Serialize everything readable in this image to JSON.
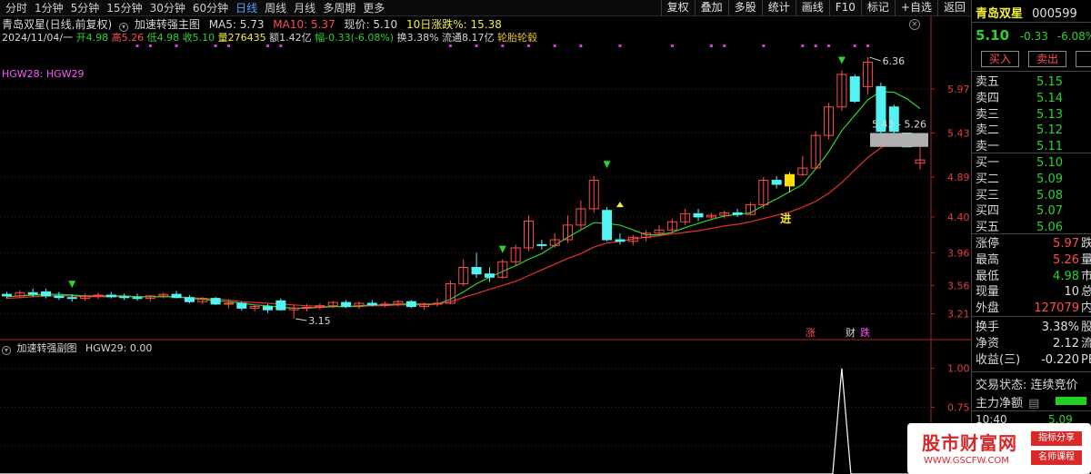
{
  "toolbar": {
    "periods": [
      "分时",
      "1分钟",
      "5分钟",
      "15分钟",
      "30分钟",
      "60分钟",
      "日线",
      "周线",
      "月线",
      "多周期",
      "更多"
    ],
    "active_period": "日线",
    "tools": [
      "复权",
      "叠加",
      "多股",
      "统计",
      "画线",
      "F10",
      "标记",
      "+自选",
      "返回"
    ]
  },
  "main_header": {
    "title": "青岛双星(日线,前复权)",
    "indicator_name": "加速转强主图",
    "ma5_label": "MA5: 5.73",
    "ma10_label": "MA10: 5.37",
    "price_label": "现价: 5.10",
    "change10_label": "10日涨跌%: 15.38",
    "date": "2024/11/04/一",
    "open": "开4.98",
    "high": "高5.26",
    "low": "低4.98",
    "close": "收5.10",
    "volume": "量276435",
    "amount": "额1.42亿",
    "amplitude": "幅-0.33(-6.08%)",
    "turnover": "换3.38%",
    "float": "流通8.17亿",
    "pattern": "轮胎轮毂",
    "hgw_label": "HGW28: HGW29"
  },
  "sub_header": {
    "indicator_name": "加速转强副图",
    "value_label": "HGW29: 0.00"
  },
  "colors": {
    "up": "#ff4d4d",
    "down": "#53f3f3",
    "ma5": "#eaeaea",
    "ma10": "#2ed12e",
    "ma20": "#e83232",
    "highlight": "#ffe000"
  },
  "chart_data": [
    {
      "type": "candlestick",
      "title": "",
      "price_ticks": [
        "5.97",
        "5.43",
        "4.89",
        "4.40",
        "3.96",
        "3.56",
        "3.21"
      ],
      "tick_values": [
        5.97,
        5.43,
        4.89,
        4.4,
        3.96,
        3.56,
        3.21
      ],
      "ylim": [
        3.05,
        6.45
      ],
      "candles": [
        [
          3.45,
          3.48,
          3.4,
          3.43
        ],
        [
          3.43,
          3.5,
          3.4,
          3.47
        ],
        [
          3.47,
          3.52,
          3.42,
          3.45
        ],
        [
          3.48,
          3.52,
          3.4,
          3.43
        ],
        [
          3.43,
          3.48,
          3.38,
          3.41
        ],
        [
          3.41,
          3.45,
          3.36,
          3.4
        ],
        [
          3.4,
          3.46,
          3.37,
          3.43
        ],
        [
          3.43,
          3.47,
          3.39,
          3.44
        ],
        [
          3.44,
          3.48,
          3.4,
          3.42
        ],
        [
          3.42,
          3.46,
          3.38,
          3.41
        ],
        [
          3.41,
          3.46,
          3.37,
          3.4
        ],
        [
          3.4,
          3.44,
          3.36,
          3.43
        ],
        [
          3.43,
          3.47,
          3.4,
          3.45
        ],
        [
          3.45,
          3.49,
          3.4,
          3.41
        ],
        [
          3.41,
          3.44,
          3.34,
          3.36
        ],
        [
          3.36,
          3.42,
          3.33,
          3.4
        ],
        [
          3.4,
          3.42,
          3.32,
          3.33
        ],
        [
          3.33,
          3.38,
          3.28,
          3.34
        ],
        [
          3.34,
          3.36,
          3.25,
          3.28
        ],
        [
          3.28,
          3.32,
          3.24,
          3.3
        ],
        [
          3.3,
          3.33,
          3.22,
          3.26
        ],
        [
          3.37,
          3.4,
          3.25,
          3.26
        ],
        [
          3.26,
          3.32,
          3.15,
          3.28
        ],
        [
          3.28,
          3.33,
          3.24,
          3.29
        ],
        [
          3.29,
          3.34,
          3.26,
          3.31
        ],
        [
          3.31,
          3.37,
          3.28,
          3.35
        ],
        [
          3.35,
          3.38,
          3.28,
          3.3
        ],
        [
          3.3,
          3.36,
          3.27,
          3.34
        ],
        [
          3.34,
          3.38,
          3.3,
          3.32
        ],
        [
          3.32,
          3.36,
          3.29,
          3.33
        ],
        [
          3.33,
          3.38,
          3.3,
          3.36
        ],
        [
          3.36,
          3.38,
          3.28,
          3.3
        ],
        [
          3.3,
          3.35,
          3.26,
          3.33
        ],
        [
          3.33,
          3.4,
          3.3,
          3.34
        ],
        [
          3.34,
          3.62,
          3.33,
          3.58
        ],
        [
          3.58,
          3.88,
          3.55,
          3.78
        ],
        [
          3.78,
          3.96,
          3.65,
          3.7
        ],
        [
          3.7,
          3.78,
          3.6,
          3.66
        ],
        [
          3.66,
          3.88,
          3.64,
          3.85
        ],
        [
          3.85,
          4.06,
          3.8,
          4.02
        ],
        [
          4.02,
          4.42,
          3.98,
          4.35
        ],
        [
          4.06,
          4.12,
          4.0,
          4.05
        ],
        [
          4.05,
          4.2,
          4.02,
          4.12
        ],
        [
          4.12,
          4.42,
          4.08,
          4.3
        ],
        [
          4.3,
          4.6,
          4.25,
          4.5
        ],
        [
          4.5,
          4.9,
          4.45,
          4.85
        ],
        [
          4.48,
          4.52,
          4.1,
          4.12
        ],
        [
          4.12,
          4.2,
          4.06,
          4.1
        ],
        [
          4.1,
          4.18,
          4.05,
          4.15
        ],
        [
          4.15,
          4.24,
          4.1,
          4.2
        ],
        [
          4.2,
          4.3,
          4.16,
          4.24
        ],
        [
          4.24,
          4.38,
          4.2,
          4.34
        ],
        [
          4.34,
          4.5,
          4.3,
          4.44
        ],
        [
          4.44,
          4.5,
          4.35,
          4.4
        ],
        [
          4.4,
          4.45,
          4.36,
          4.42
        ],
        [
          4.42,
          4.48,
          4.38,
          4.45
        ],
        [
          4.45,
          4.5,
          4.4,
          4.43
        ],
        [
          4.43,
          4.58,
          4.42,
          4.55
        ],
        [
          4.55,
          4.89,
          4.5,
          4.85
        ],
        [
          4.85,
          4.9,
          4.75,
          4.8
        ],
        [
          4.78,
          4.95,
          4.7,
          4.92
        ],
        [
          4.92,
          5.15,
          4.9,
          5.0
        ],
        [
          5.0,
          5.45,
          4.98,
          5.4
        ],
        [
          5.4,
          5.8,
          5.35,
          5.75
        ],
        [
          5.75,
          6.2,
          5.7,
          6.15
        ],
        [
          6.12,
          6.15,
          5.8,
          5.82
        ],
        [
          6.0,
          6.36,
          5.9,
          6.3
        ],
        [
          6.0,
          6.05,
          5.35,
          5.45
        ],
        [
          5.75,
          5.78,
          5.4,
          5.45
        ],
        [
          5.43,
          5.43,
          5.26,
          5.26
        ],
        [
          5.06,
          5.26,
          4.98,
          5.1
        ]
      ],
      "ma10": [
        3.4,
        3.41,
        3.42,
        3.43,
        3.43,
        3.43,
        3.42,
        3.42,
        3.42,
        3.42,
        3.42,
        3.42,
        3.42,
        3.42,
        3.41,
        3.4,
        3.39,
        3.38,
        3.36,
        3.35,
        3.34,
        3.33,
        3.32,
        3.31,
        3.3,
        3.3,
        3.3,
        3.3,
        3.31,
        3.31,
        3.32,
        3.32,
        3.32,
        3.33,
        3.36,
        3.41,
        3.46,
        3.51,
        3.56,
        3.61,
        3.68,
        3.75,
        3.82,
        3.89,
        3.95,
        4.03,
        4.08,
        4.1,
        4.13,
        4.15,
        4.17,
        4.19,
        4.21,
        4.23,
        4.26,
        4.29,
        4.31,
        4.34,
        4.38,
        4.42,
        4.46,
        4.52,
        4.59,
        4.69,
        4.82,
        4.98,
        5.13,
        5.25,
        5.32,
        5.37,
        5.37
      ],
      "ma5": [
        3.42,
        3.43,
        3.44,
        3.45,
        3.45,
        3.44,
        3.43,
        3.43,
        3.43,
        3.43,
        3.42,
        3.42,
        3.42,
        3.42,
        3.4,
        3.39,
        3.37,
        3.36,
        3.34,
        3.32,
        3.31,
        3.29,
        3.28,
        3.28,
        3.29,
        3.3,
        3.3,
        3.31,
        3.32,
        3.32,
        3.33,
        3.33,
        3.33,
        3.33,
        3.39,
        3.48,
        3.58,
        3.66,
        3.73,
        3.8,
        3.88,
        3.95,
        4.05,
        4.15,
        4.24,
        4.33,
        4.32,
        4.3,
        4.24,
        4.18,
        4.18,
        4.21,
        4.27,
        4.32,
        4.37,
        4.41,
        4.43,
        4.45,
        4.54,
        4.62,
        4.71,
        4.8,
        4.99,
        5.2,
        5.46,
        5.65,
        5.84,
        5.94,
        5.93,
        5.85,
        5.73
      ],
      "annotations": [
        {
          "label": "6.36",
          "candle": 66
        },
        {
          "label": "3.15",
          "candle": 22
        },
        {
          "label": "5.43 - 5.26",
          "candle": 69
        }
      ],
      "signal_text": "进",
      "tags": [
        "涨",
        "财",
        "跌"
      ]
    },
    {
      "type": "line",
      "title": "",
      "ticks": [
        "1.00",
        "0.75",
        "0.50"
      ],
      "tick_values": [
        1.0,
        0.75,
        0.5
      ],
      "ylim": [
        0.32,
        1.08
      ],
      "spike_candle": 64,
      "spike_value": 1.0
    }
  ],
  "quote": {
    "name": "青岛双星",
    "code": "000599",
    "price": "5.10",
    "change": "-0.33",
    "pct": "-6.08%",
    "buy_label": "买入",
    "sell_label": "卖出",
    "sell_book": [
      {
        "label": "卖五",
        "price": "5.15"
      },
      {
        "label": "卖四",
        "price": "5.14"
      },
      {
        "label": "卖三",
        "price": "5.13"
      },
      {
        "label": "卖二",
        "price": "5.12"
      },
      {
        "label": "卖一",
        "price": "5.11"
      }
    ],
    "buy_book": [
      {
        "label": "买一",
        "price": "5.10"
      },
      {
        "label": "买二",
        "price": "5.09"
      },
      {
        "label": "买三",
        "price": "5.08"
      },
      {
        "label": "买四",
        "price": "5.07"
      },
      {
        "label": "买五",
        "price": "5.06"
      }
    ],
    "stats1": [
      {
        "label": "涨停",
        "value": "5.97",
        "suffix": "跌"
      },
      {
        "label": "最高",
        "value": "5.26",
        "suffix": "量"
      },
      {
        "label": "最低",
        "value": "4.98",
        "suffix": "市"
      },
      {
        "label": "现量",
        "value": "10",
        "suffix": "总"
      },
      {
        "label": "外盘",
        "value": "127079",
        "suffix": "内"
      }
    ],
    "stats2": [
      {
        "label": "换手",
        "value": "3.38%",
        "suffix": "股"
      },
      {
        "label": "净资",
        "value": "2.12",
        "suffix": "流"
      },
      {
        "label": "收益(三)",
        "value": "-0.220",
        "suffix": "PE"
      }
    ],
    "trade_status": "交易状态: 连续竞价",
    "net_label": "主力净额",
    "tick_time": "10:40",
    "tick_price": "5.09"
  },
  "watermark": {
    "main": "股市财富网",
    "url": "WWW.GSCFW.COM",
    "tag1": "指标分享",
    "tag2": "名师课程"
  }
}
